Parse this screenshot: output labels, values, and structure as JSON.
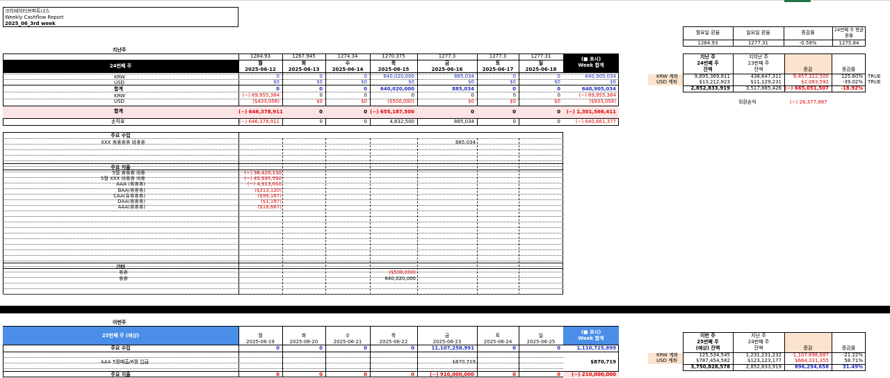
{
  "header": {
    "company": "크리에이티브파트너스",
    "report": "Weekly Cashflow Report",
    "week": "2025_06_3rd week"
  },
  "fx": {
    "headers": [
      "월요일 환율",
      "일요일 환율",
      "증감률",
      "24번째 주 평균환율"
    ],
    "values": [
      "1284.93",
      "1277.31",
      "-0.59%",
      "1275.84"
    ]
  },
  "last": {
    "label": "지난주",
    "week": "24번째 주",
    "rates": [
      "1284.93",
      "1267.945",
      "1274.34",
      "1270.375",
      "1277.3",
      "1277.3",
      "1277.31"
    ],
    "days": [
      "월",
      "화",
      "수",
      "목",
      "금",
      "토",
      "일"
    ],
    "dates": [
      "2025-06-12",
      "2025-06-13",
      "2025-06-14",
      "2025-06-15",
      "2025-06-16",
      "2025-06-17",
      "2025-06-18"
    ],
    "total_head": "(■ 표시)",
    "total_sub": "Week 합계",
    "krw_label": "KRW",
    "usd_label": "USD",
    "sum_label": "합계",
    "fx_row_label": "손익표",
    "rows1": {
      "krw": [
        "0",
        "0",
        "0",
        "640,020,000",
        "885,034",
        "0",
        "0",
        "640,905,034"
      ],
      "usd": [
        "$0",
        "$0",
        "$0",
        "$0",
        "$0",
        "$0",
        "$0",
        "$0"
      ],
      "sum": [
        "0",
        "0",
        "0",
        "640,020,000",
        "885,034",
        "0",
        "0",
        "640,905,034"
      ]
    },
    "rows2": {
      "krw": [
        "(−) 89,955,384",
        "0",
        "0",
        "0",
        "0",
        "0",
        "0",
        "(−) 89,955,384"
      ],
      "usd": [
        "($433,058)",
        "$0",
        "$0",
        "($500,000)",
        "$0",
        "$0",
        "$0",
        "($933,058)"
      ],
      "sum": [
        "(−) 646,378,911",
        "0",
        "0",
        "(−) 655,187,500",
        "0",
        "0",
        "0",
        "(−) 1,301,566,411"
      ],
      "fx": [
        "(−) 646,378,911",
        "0",
        "0",
        "4,832,500",
        "885,034",
        "0",
        "0",
        "(−) 640,661,377"
      ]
    }
  },
  "income": {
    "title": "주요 수입",
    "item": "XXX 휴휴휴휴 바휴휴",
    "value": "885,034"
  },
  "expense": {
    "title": "주요 지출",
    "items": [
      "5월 휴휴휴 바휴",
      "5월 XXX 바휴휴 바휴",
      "AAA (휴휴휴)",
      "BAA(휴휴휴)",
      "CAA(유휴휴휴)",
      "DAA(휴휴휴)",
      "AAA(휴휴휴)"
    ],
    "values": [
      "(−) 36,420,130",
      "(−) 45,995,590",
      "(−) 4,913,000",
      "($313,120)",
      "($99,167)",
      "($1,197)",
      "($18,667)"
    ]
  },
  "other": {
    "title": "기타",
    "items": [
      "휴휴",
      "휴휴"
    ],
    "values": [
      "($500,000)",
      "640,020,000"
    ]
  },
  "summary": {
    "h1": [
      "지난 주",
      "24번째 주",
      "잔액"
    ],
    "h2": [
      "지지난 주",
      "23번째 주",
      "잔액"
    ],
    "h3": "증감",
    "h4": "증감률",
    "rows": [
      {
        "label": "KRW 계좌",
        "a": "9,895,369,811",
        "b": "438,647,311",
        "c": "9,457,322,500",
        "d": "125.60%",
        "e": "TRUE"
      },
      {
        "label": "USD 계좌",
        "a": "$13,212,823",
        "b": "$11,129,231",
        "c": "$2,083,592",
        "d": "-39.02%",
        "e": "TRUE"
      }
    ],
    "total": {
      "a": "2,852,833,919",
      "b": "3,517,885,426",
      "c": "(−) 665,051,507",
      "d": "-18.92%"
    },
    "fx_label": "외환손익",
    "fx_value": "(−) 26,377,887"
  },
  "next": {
    "label": "이번주",
    "week": "25번째 주 (예상)",
    "days": [
      "월",
      "화",
      "수",
      "목",
      "금",
      "토",
      "일"
    ],
    "dates": [
      "2025-06-19",
      "2025-06-20",
      "2025-06-21",
      "2025-06-22",
      "2025-06-23",
      "2025-06-24",
      "2025-06-25"
    ],
    "total_head": "(■ 표시)",
    "total_sub": "Week 합계",
    "income_title": "주요 수입",
    "income": [
      "0",
      "0",
      "0",
      "0",
      "11,107,258,991",
      "0",
      "0",
      "1,110,725,899"
    ],
    "income_item": "AAA 5월매출/6월 입금",
    "income_item_val": "$870,719",
    "income_item_total": "$870,719",
    "expense_title": "주요 지출",
    "expense": [
      "0",
      "0",
      "0",
      "0",
      "(−) 910,000,000",
      "0",
      "0",
      "(−) 210,000,000"
    ]
  },
  "summary2": {
    "h1": [
      "이번 주",
      "25번째 주",
      "(예상) 잔액"
    ],
    "h2": [
      "지난 주",
      "24번째 주",
      "잔액"
    ],
    "h3": "증감",
    "h4": "증감률",
    "rows": [
      {
        "label": "KRW 계좌",
        "a": "125,534,545",
        "b": "1,231,231,232",
        "c": "-1,107,696,687",
        "d": "-21.22%"
      },
      {
        "label": "USD 계좌",
        "a": "$787,454,582",
        "b": "$123,123,177",
        "c": "$664,331,355",
        "d": "58.71%"
      }
    ],
    "total": {
      "a": "3,750,828,578",
      "b": "2,852,833,919",
      "c": "896,294,658",
      "d": "31.49%"
    }
  }
}
